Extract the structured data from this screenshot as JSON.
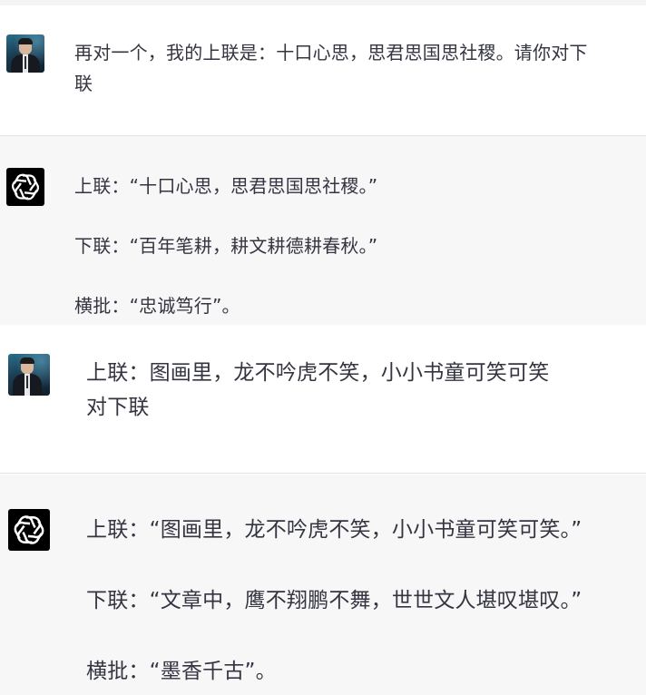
{
  "conversation": {
    "messages": [
      {
        "role": "user",
        "avatar": "user-photo-avatar",
        "lines": [
          "再对一个，我的上联是：十口心思，思君思国思社稷。请你对下",
          "联"
        ]
      },
      {
        "role": "assistant",
        "avatar": "openai-logo-icon",
        "lines": [
          "上联：“十口心思，思君思国思社稷。”",
          "下联：“百年笔耕，耕文耕德耕春秋。”",
          "横批：“忠诚笃行”。"
        ]
      },
      {
        "role": "user",
        "avatar": "user-photo-avatar",
        "lines": [
          "上联：图画里，龙不吟虎不笑，小小书童可笑可笑",
          "对下联"
        ]
      },
      {
        "role": "assistant",
        "avatar": "openai-logo-icon",
        "lines": [
          "上联：“图画里，龙不吟虎不笑，小小书童可笑可笑。”",
          "下联：“文章中，鹰不翔鹏不舞，世世文人堪叹堪叹。”",
          "横批：“墨香千古”。"
        ]
      }
    ]
  },
  "colors": {
    "user_bg": "#ffffff",
    "assistant_bg": "#f7f7f8",
    "text": "#343541",
    "assistant_avatar_bg": "#000000",
    "divider": "#e3e3e6"
  }
}
